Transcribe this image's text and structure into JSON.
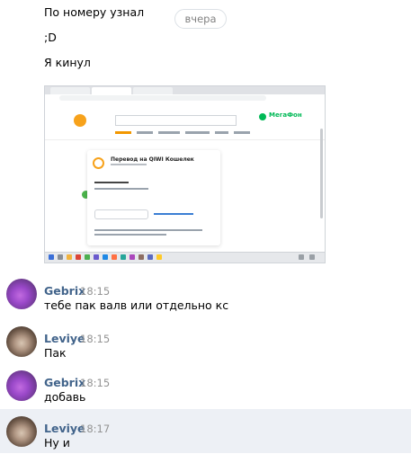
{
  "chat": {
    "date_divider": "вчера",
    "top_messages": [
      "По номеру узнал",
      ";D",
      "Я кинул"
    ],
    "attachment": {
      "site_brand": "МегаФон",
      "card_title": "Перевод на QIWI Кошелек"
    },
    "messages": [
      {
        "author": "Gebrix",
        "time": "18:15",
        "text": "тебе пак валв или отдельно кс"
      },
      {
        "author": "Leviye",
        "time": "18:15",
        "text": "Пак"
      },
      {
        "author": "Gebrix",
        "time": "18:15",
        "text": "добавь"
      },
      {
        "author": "Leviye",
        "time": "18:17",
        "text": "Ну и"
      }
    ]
  },
  "colors": {
    "author_link": "#42648b",
    "time_gray": "#939393",
    "highlight_row": "#edf0f5",
    "qiwi_orange": "#f7a21b",
    "megafon_green": "#00b956"
  }
}
